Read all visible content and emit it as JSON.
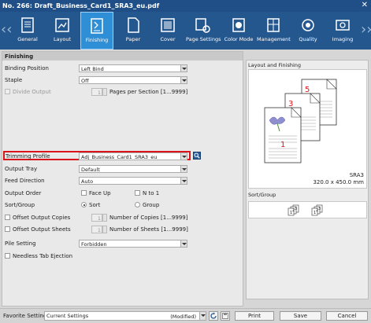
{
  "window": {
    "title": "No. 266: Draft_Business_Card1_SRA3_eu.pdf",
    "close_glyph": "✕"
  },
  "toolbar": {
    "nav_prev": "‹‹",
    "nav_next": "››",
    "tabs": [
      {
        "label": "General",
        "icon": "document-list-icon"
      },
      {
        "label": "Layout",
        "icon": "layout-icon"
      },
      {
        "label": "Finishing",
        "icon": "finishing-icon",
        "active": true
      },
      {
        "label": "Paper",
        "icon": "paper-icon"
      },
      {
        "label": "Cover",
        "icon": "cover-icon"
      },
      {
        "label": "Page Settings",
        "icon": "page-settings-icon"
      },
      {
        "label": "Color Mode",
        "icon": "color-mode-icon"
      },
      {
        "label": "Management",
        "icon": "management-icon"
      },
      {
        "label": "Quality",
        "icon": "quality-icon"
      },
      {
        "label": "Imaging",
        "icon": "imaging-icon"
      }
    ]
  },
  "finishing": {
    "section_title": "Finishing",
    "binding_position": {
      "label": "Binding Position",
      "value": "Left Bind"
    },
    "staple": {
      "label": "Staple",
      "value": "Off"
    },
    "divide_output": {
      "label": "Divide Output",
      "value": "1",
      "suffix": "Pages per Section [1...9999]"
    },
    "trimming_profile": {
      "label": "Trimming Profile",
      "value": "Adj_Business_Card1_SRA3_eu"
    },
    "output_tray": {
      "label": "Output Tray",
      "value": "Default"
    },
    "feed_direction": {
      "label": "Feed Direction",
      "value": "Auto"
    },
    "output_order": {
      "label": "Output Order",
      "opt1": "Face Up",
      "opt2": "N to 1"
    },
    "sort_group": {
      "label": "Sort/Group",
      "opt1": "Sort",
      "opt2": "Group"
    },
    "offset_copies": {
      "label": "Offset Output Copies",
      "value": "1",
      "suffix": "Number of Copies [1...9999]"
    },
    "offset_sheets": {
      "label": "Offset Output Sheets",
      "value": "1",
      "suffix": "Number of Sheets [1...9999]"
    },
    "pile_setting": {
      "label": "Pile Setting",
      "value": "Forbidden"
    },
    "needless_tab": {
      "label": "Needless Tab Ejection"
    }
  },
  "right_panel": {
    "layout_title": "Layout and Finishing",
    "page_numbers": [
      "5",
      "3",
      "1"
    ],
    "paper_name": "SRA3",
    "paper_size": "320.0 x 450.0 mm",
    "sort_title": "Sort/Group",
    "sort_numbers": [
      "3",
      "2",
      "1",
      "3",
      "2",
      "1"
    ]
  },
  "footer": {
    "favorite_label": "Favorite Setting",
    "favorite_value": "Current Settings",
    "modified": "(Modified)",
    "print": "Print",
    "save": "Save",
    "cancel": "Cancel"
  },
  "colors": {
    "titlebar": "#1f4f86",
    "toolbar": "#25578f",
    "active_tab": "#2f8fd6",
    "highlight": "#d9141a"
  }
}
